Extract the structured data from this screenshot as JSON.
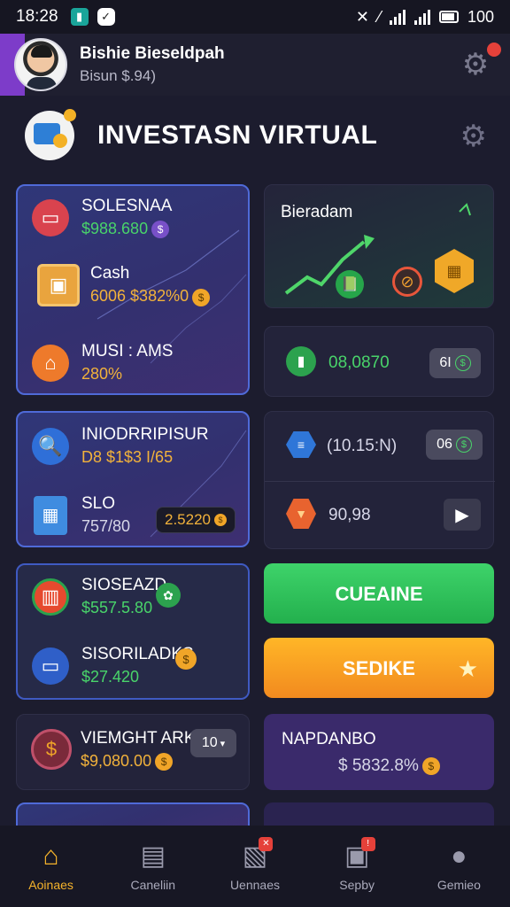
{
  "status": {
    "time": "18:28",
    "battery": "100"
  },
  "profile": {
    "name": "Bishie Bieseldpah",
    "balance": "Bisun  $.94)"
  },
  "page": {
    "title": "INVESTASN VIRTUAL"
  },
  "cards": {
    "savings": {
      "label": "SOLESNAA",
      "value": "$988.680"
    },
    "cash": {
      "label": "Cash",
      "value": "6006 $382%0"
    },
    "music": {
      "label": "MUSI : AMS",
      "value": "280%"
    },
    "market": {
      "label": "Bieradam"
    },
    "market_stat": {
      "value": "08,0870",
      "pill": "6I"
    },
    "inod": {
      "label": "INIODRRIPISUR",
      "value": "D8 $1$3 I/65"
    },
    "slo": {
      "label": "SLO",
      "value": "757/80",
      "pill": "2.5220"
    },
    "stat2": {
      "value": "(10.15:N)",
      "pill": "06"
    },
    "stat3": {
      "value": "90,98"
    },
    "siosead": {
      "label": "SIOSEAZD",
      "value": "$557.5.80"
    },
    "siosrl": {
      "label": "SISORILADKS",
      "value": "$27.420"
    },
    "vm": {
      "label": "VIEMGHT ARK",
      "value": "$9,080.00",
      "pill": "10"
    },
    "napo": {
      "label": "NAPDANBO",
      "value": "$ 5832.8%"
    }
  },
  "actions": {
    "green": "CUEAINE",
    "orange": "SEDIKE"
  },
  "nav": [
    {
      "label": "Aoinaes",
      "icon": "home-icon",
      "active": true
    },
    {
      "label": "Caneliin",
      "icon": "document-icon",
      "active": false
    },
    {
      "label": "Uennaes",
      "icon": "chart-card-icon",
      "active": false
    },
    {
      "label": "Sepby",
      "icon": "user-card-icon",
      "active": false
    },
    {
      "label": "Gemieo",
      "icon": "person-icon",
      "active": false
    }
  ],
  "colors": {
    "accent_green": "#3ed36a",
    "accent_orange": "#f28a1f",
    "accent_purple": "#7d3cc9",
    "card_border_blue": "#4f6ad8"
  }
}
